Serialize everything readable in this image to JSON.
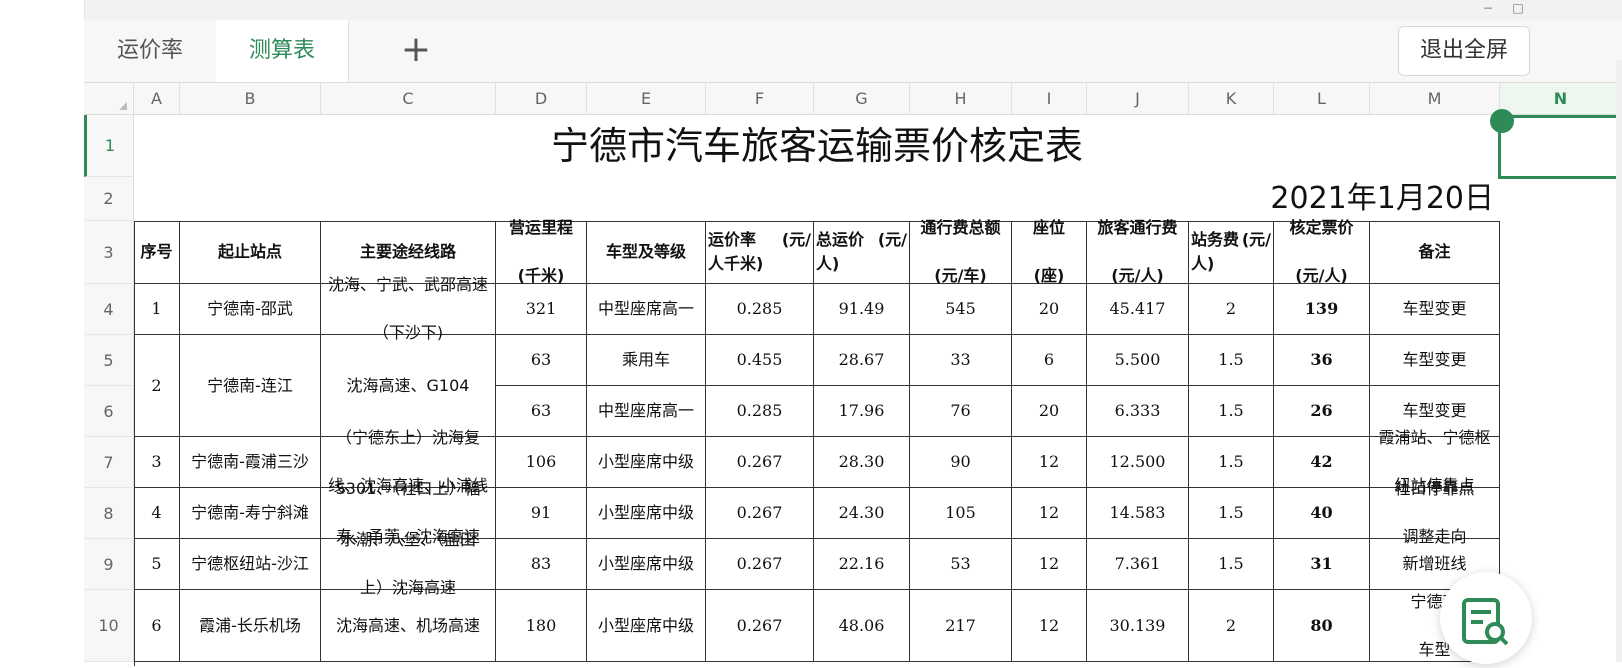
{
  "tabs": [
    {
      "label": "运价率",
      "active": false
    },
    {
      "label": "测算表",
      "active": true
    }
  ],
  "add_tab_label": "+",
  "exit_fullscreen_label": "退出全屏",
  "window_controls": {
    "minimize": "−",
    "maximize": "□"
  },
  "columns": [
    "A",
    "B",
    "C",
    "D",
    "E",
    "F",
    "G",
    "H",
    "I",
    "J",
    "K",
    "L",
    "M",
    "N"
  ],
  "selected_column": "N",
  "rows": [
    "1",
    "2",
    "3",
    "4",
    "5",
    "6",
    "7",
    "8",
    "9",
    "10"
  ],
  "selected_row": "1",
  "sheet": {
    "title": "宁德市汽车旅客运输票价核定表",
    "date": "2021年1月20日",
    "headers": {
      "seq": "序号",
      "route": "起止站点",
      "via": "主要途经线路",
      "mileage": [
        "营运里程",
        "(千米)"
      ],
      "vehicle": "车型及等级",
      "rate": [
        "运价率",
        "(元/",
        "人千米)"
      ],
      "total_fare": [
        "总运价",
        "(元/",
        "人)"
      ],
      "toll_total": [
        "通行费总额",
        "(元/车)"
      ],
      "seats": [
        "座位",
        "(座)"
      ],
      "toll_per": [
        "旅客通行费",
        "(元/人)"
      ],
      "station_fee": [
        "站务费",
        "(元/",
        "人)"
      ],
      "approved": [
        "核定票价",
        "(元/人)"
      ],
      "remark": "备注"
    },
    "data": [
      {
        "seq": "1",
        "route": "宁德南-邵武",
        "via": [
          "沈海、宁武、武邵高速",
          "（下沙下)"
        ],
        "mileage": "321",
        "vehicle": "中型座席高一",
        "rate": "0.285",
        "total": "91.49",
        "toll": "545",
        "seats": "20",
        "toll_per": "45.417",
        "station": "2",
        "price": "139",
        "remark": [
          "车型变更"
        ]
      },
      {
        "seq": "2",
        "route": "宁德南-连江",
        "via": [
          "沈海高速、G104"
        ],
        "mileage": "63",
        "vehicle": "乘用车",
        "rate": "0.455",
        "total": "28.67",
        "toll": "33",
        "seats": "6",
        "toll_per": "5.500",
        "station": "1.5",
        "price": "36",
        "remark": [
          "车型变更"
        ]
      },
      {
        "seq": "",
        "route": "",
        "via": [],
        "mileage": "63",
        "vehicle": "中型座席高一",
        "rate": "0.285",
        "total": "17.96",
        "toll": "76",
        "seats": "20",
        "toll_per": "6.333",
        "station": "1.5",
        "price": "26",
        "remark": [
          "车型变更"
        ]
      },
      {
        "seq": "3",
        "route": "宁德南-霞浦三沙",
        "via": [
          "（宁德东上）沈海复",
          "线、沈海高速、小浦线"
        ],
        "mileage": "106",
        "vehicle": "小型座席中级",
        "rate": "0.267",
        "total": "28.30",
        "toll": "90",
        "seats": "12",
        "toll_per": "12.500",
        "station": "1.5",
        "price": "42",
        "remark": [
          "霞浦站、宁德枢",
          "纽站停靠点"
        ]
      },
      {
        "seq": "4",
        "route": "宁德南-寿宁斜滩",
        "via": [
          "S301、（社口上）福",
          "寿、甬莞、沈海高速"
        ],
        "mileage": "91",
        "vehicle": "小型座席中级",
        "rate": "0.267",
        "total": "24.30",
        "toll": "105",
        "seats": "12",
        "toll_per": "14.583",
        "station": "1.5",
        "price": "40",
        "remark": [
          "社口停靠点",
          "调整走向"
        ]
      },
      {
        "seq": "5",
        "route": "宁德枢纽站-沙江",
        "via": [
          "水潮、八堡、（盐田",
          "上）沈海高速"
        ],
        "mileage": "83",
        "vehicle": "小型座席中级",
        "rate": "0.267",
        "total": "22.16",
        "toll": "53",
        "seats": "12",
        "toll_per": "7.361",
        "station": "1.5",
        "price": "31",
        "remark": [
          "新增班线"
        ]
      },
      {
        "seq": "6",
        "route": "霞浦-长乐机场",
        "via": [
          "沈海高速、机场高速"
        ],
        "mileage": "180",
        "vehicle": "小型座席中级",
        "rate": "0.267",
        "total": "48.06",
        "toll": "217",
        "seats": "12",
        "toll_per": "30.139",
        "station": "2",
        "price": "80",
        "remark": [
          "宁德南",
          "车型"
        ]
      }
    ]
  }
}
